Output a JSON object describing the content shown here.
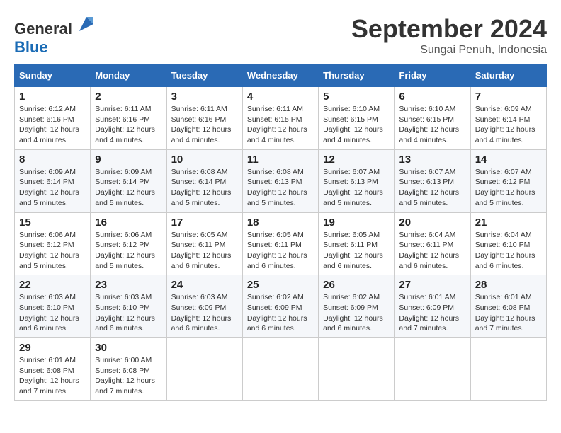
{
  "header": {
    "logo_general": "General",
    "logo_blue": "Blue",
    "month": "September 2024",
    "location": "Sungai Penuh, Indonesia"
  },
  "weekdays": [
    "Sunday",
    "Monday",
    "Tuesday",
    "Wednesday",
    "Thursday",
    "Friday",
    "Saturday"
  ],
  "weeks": [
    [
      {
        "day": "1",
        "sunrise": "Sunrise: 6:12 AM",
        "sunset": "Sunset: 6:16 PM",
        "daylight": "Daylight: 12 hours and 4 minutes."
      },
      {
        "day": "2",
        "sunrise": "Sunrise: 6:11 AM",
        "sunset": "Sunset: 6:16 PM",
        "daylight": "Daylight: 12 hours and 4 minutes."
      },
      {
        "day": "3",
        "sunrise": "Sunrise: 6:11 AM",
        "sunset": "Sunset: 6:16 PM",
        "daylight": "Daylight: 12 hours and 4 minutes."
      },
      {
        "day": "4",
        "sunrise": "Sunrise: 6:11 AM",
        "sunset": "Sunset: 6:15 PM",
        "daylight": "Daylight: 12 hours and 4 minutes."
      },
      {
        "day": "5",
        "sunrise": "Sunrise: 6:10 AM",
        "sunset": "Sunset: 6:15 PM",
        "daylight": "Daylight: 12 hours and 4 minutes."
      },
      {
        "day": "6",
        "sunrise": "Sunrise: 6:10 AM",
        "sunset": "Sunset: 6:15 PM",
        "daylight": "Daylight: 12 hours and 4 minutes."
      },
      {
        "day": "7",
        "sunrise": "Sunrise: 6:09 AM",
        "sunset": "Sunset: 6:14 PM",
        "daylight": "Daylight: 12 hours and 4 minutes."
      }
    ],
    [
      {
        "day": "8",
        "sunrise": "Sunrise: 6:09 AM",
        "sunset": "Sunset: 6:14 PM",
        "daylight": "Daylight: 12 hours and 5 minutes."
      },
      {
        "day": "9",
        "sunrise": "Sunrise: 6:09 AM",
        "sunset": "Sunset: 6:14 PM",
        "daylight": "Daylight: 12 hours and 5 minutes."
      },
      {
        "day": "10",
        "sunrise": "Sunrise: 6:08 AM",
        "sunset": "Sunset: 6:14 PM",
        "daylight": "Daylight: 12 hours and 5 minutes."
      },
      {
        "day": "11",
        "sunrise": "Sunrise: 6:08 AM",
        "sunset": "Sunset: 6:13 PM",
        "daylight": "Daylight: 12 hours and 5 minutes."
      },
      {
        "day": "12",
        "sunrise": "Sunrise: 6:07 AM",
        "sunset": "Sunset: 6:13 PM",
        "daylight": "Daylight: 12 hours and 5 minutes."
      },
      {
        "day": "13",
        "sunrise": "Sunrise: 6:07 AM",
        "sunset": "Sunset: 6:13 PM",
        "daylight": "Daylight: 12 hours and 5 minutes."
      },
      {
        "day": "14",
        "sunrise": "Sunrise: 6:07 AM",
        "sunset": "Sunset: 6:12 PM",
        "daylight": "Daylight: 12 hours and 5 minutes."
      }
    ],
    [
      {
        "day": "15",
        "sunrise": "Sunrise: 6:06 AM",
        "sunset": "Sunset: 6:12 PM",
        "daylight": "Daylight: 12 hours and 5 minutes."
      },
      {
        "day": "16",
        "sunrise": "Sunrise: 6:06 AM",
        "sunset": "Sunset: 6:12 PM",
        "daylight": "Daylight: 12 hours and 5 minutes."
      },
      {
        "day": "17",
        "sunrise": "Sunrise: 6:05 AM",
        "sunset": "Sunset: 6:11 PM",
        "daylight": "Daylight: 12 hours and 6 minutes."
      },
      {
        "day": "18",
        "sunrise": "Sunrise: 6:05 AM",
        "sunset": "Sunset: 6:11 PM",
        "daylight": "Daylight: 12 hours and 6 minutes."
      },
      {
        "day": "19",
        "sunrise": "Sunrise: 6:05 AM",
        "sunset": "Sunset: 6:11 PM",
        "daylight": "Daylight: 12 hours and 6 minutes."
      },
      {
        "day": "20",
        "sunrise": "Sunrise: 6:04 AM",
        "sunset": "Sunset: 6:11 PM",
        "daylight": "Daylight: 12 hours and 6 minutes."
      },
      {
        "day": "21",
        "sunrise": "Sunrise: 6:04 AM",
        "sunset": "Sunset: 6:10 PM",
        "daylight": "Daylight: 12 hours and 6 minutes."
      }
    ],
    [
      {
        "day": "22",
        "sunrise": "Sunrise: 6:03 AM",
        "sunset": "Sunset: 6:10 PM",
        "daylight": "Daylight: 12 hours and 6 minutes."
      },
      {
        "day": "23",
        "sunrise": "Sunrise: 6:03 AM",
        "sunset": "Sunset: 6:10 PM",
        "daylight": "Daylight: 12 hours and 6 minutes."
      },
      {
        "day": "24",
        "sunrise": "Sunrise: 6:03 AM",
        "sunset": "Sunset: 6:09 PM",
        "daylight": "Daylight: 12 hours and 6 minutes."
      },
      {
        "day": "25",
        "sunrise": "Sunrise: 6:02 AM",
        "sunset": "Sunset: 6:09 PM",
        "daylight": "Daylight: 12 hours and 6 minutes."
      },
      {
        "day": "26",
        "sunrise": "Sunrise: 6:02 AM",
        "sunset": "Sunset: 6:09 PM",
        "daylight": "Daylight: 12 hours and 6 minutes."
      },
      {
        "day": "27",
        "sunrise": "Sunrise: 6:01 AM",
        "sunset": "Sunset: 6:09 PM",
        "daylight": "Daylight: 12 hours and 7 minutes."
      },
      {
        "day": "28",
        "sunrise": "Sunrise: 6:01 AM",
        "sunset": "Sunset: 6:08 PM",
        "daylight": "Daylight: 12 hours and 7 minutes."
      }
    ],
    [
      {
        "day": "29",
        "sunrise": "Sunrise: 6:01 AM",
        "sunset": "Sunset: 6:08 PM",
        "daylight": "Daylight: 12 hours and 7 minutes."
      },
      {
        "day": "30",
        "sunrise": "Sunrise: 6:00 AM",
        "sunset": "Sunset: 6:08 PM",
        "daylight": "Daylight: 12 hours and 7 minutes."
      },
      null,
      null,
      null,
      null,
      null
    ]
  ]
}
